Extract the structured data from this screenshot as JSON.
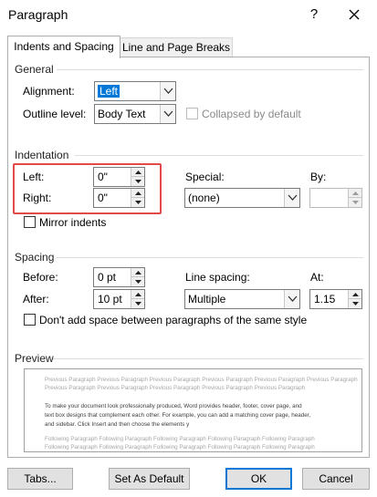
{
  "window": {
    "title": "Paragraph",
    "help": "?"
  },
  "tabs": [
    {
      "label": "Indents and Spacing",
      "active": true
    },
    {
      "label": "Line and Page Breaks",
      "active": false
    }
  ],
  "general": {
    "heading": "General",
    "alignment": {
      "label": "Alignment:",
      "value": "Left"
    },
    "outline_level": {
      "label": "Outline level:",
      "value": "Body Text"
    },
    "collapsed": {
      "label": "Collapsed by default",
      "checked": false,
      "enabled": false
    }
  },
  "indentation": {
    "heading": "Indentation",
    "left": {
      "label": "Left:",
      "value": "0\""
    },
    "right": {
      "label": "Right:",
      "value": "0\""
    },
    "special": {
      "label": "Special:",
      "value": "(none)"
    },
    "by": {
      "label": "By:",
      "value": ""
    },
    "mirror": {
      "label": "Mirror indents",
      "checked": false
    }
  },
  "spacing": {
    "heading": "Spacing",
    "before": {
      "label": "Before:",
      "value": "0 pt"
    },
    "after": {
      "label": "After:",
      "value": "10 pt"
    },
    "line_spacing": {
      "label": "Line spacing:",
      "value": "Multiple"
    },
    "at": {
      "label": "At:",
      "value": "1.15"
    },
    "dont_add": {
      "label": "Don't add space between paragraphs of the same style",
      "checked": false
    }
  },
  "preview": {
    "heading": "Preview",
    "previous_lines": [
      "Previous Paragraph Previous Paragraph Previous Paragraph Previous Paragraph Previous Paragraph Previous Paragraph",
      "Previous Paragraph Previous Paragraph Previous Paragraph Previous Paragraph Previous Paragraph"
    ],
    "sample_lines": [
      "To make your document look professionally produced, Word provides header, footer, cover page, and",
      "text box designs that complement each other. For example, you can add a matching cover page, header,",
      "and sidebar. Click Insert and then choose the elements y"
    ],
    "following_lines": [
      "Following Paragraph Following Paragraph Following Paragraph Following Paragraph Following Paragraph",
      "Following Paragraph Following Paragraph Following Paragraph Following Paragraph Following Paragraph"
    ]
  },
  "buttons": {
    "tabs": "Tabs...",
    "set_as_default": "Set As Default",
    "ok": "OK",
    "cancel": "Cancel"
  },
  "colors": {
    "highlight": "#0078d7",
    "callout": "#e24a4a"
  }
}
